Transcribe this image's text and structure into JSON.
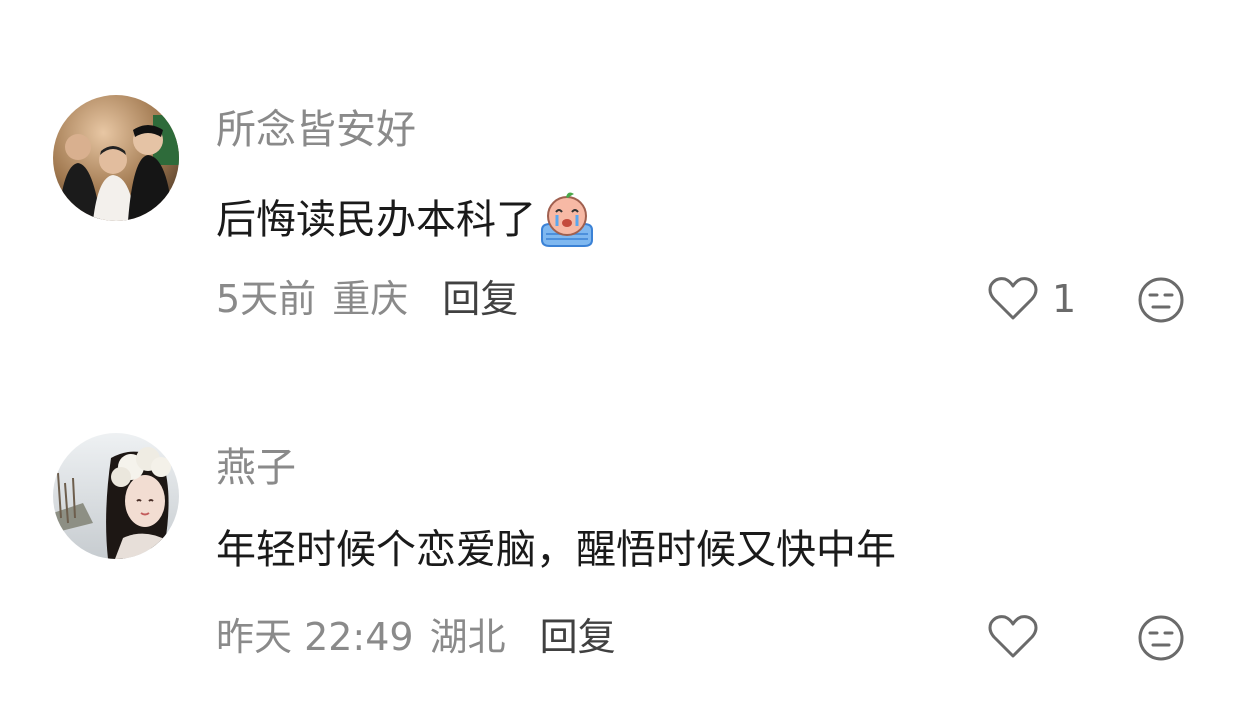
{
  "comments": [
    {
      "username": "所念皆安好",
      "text": "后悔读民办本科了",
      "emoji": "crying-emoji",
      "time": "5天前",
      "location": "重庆",
      "reply_label": "回复",
      "like_count": "1",
      "avatar_icon": "group-photo-avatar"
    },
    {
      "username": "燕子",
      "text": "年轻时候个恋爱脑，醒悟时候又快中年",
      "time": "昨天 22:49",
      "location": "湖北",
      "reply_label": "回复",
      "like_count": "",
      "avatar_icon": "woman-portrait-avatar"
    }
  ],
  "icons": {
    "like": "heart-outline-icon",
    "dislike": "neutral-face-icon"
  },
  "colors": {
    "username": "#8a8a8a",
    "text": "#1a1a1a",
    "meta": "#8a8a8a",
    "reply": "#404040",
    "icon_stroke": "#6a6a6a"
  }
}
